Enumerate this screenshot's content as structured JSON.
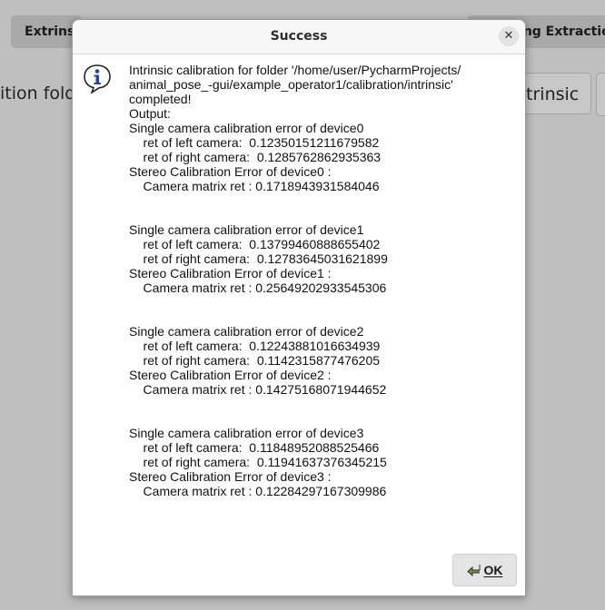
{
  "background": {
    "tab_extrinsic": "Extrinsi",
    "tab_extraction": "ding Extraction",
    "calibration_folder_label": "ition folde",
    "intrinsic_button": "ntrinsic"
  },
  "dialog": {
    "title": "Success",
    "close_icon": "close-icon",
    "icon": "info-icon",
    "message": "Intrinsic calibration for folder '/home/user/PycharmProjects/\nanimal_pose_-gui/example_operator1/calibration/intrinsic'\ncompleted!\nOutput:\nSingle camera calibration error of device0\n    ret of left camera:  0.12350151211679582\n    ret of right camera:  0.1285762862935363\nStereo Calibration Error of device0 :\n    Camera matrix ret : 0.1718943931584046\n\n\nSingle camera calibration error of device1\n    ret of left camera:  0.13799460888655402\n    ret of right camera:  0.12783645031621899\nStereo Calibration Error of device1 :\n    Camera matrix ret : 0.25649202933545306\n\n\nSingle camera calibration error of device2\n    ret of left camera:  0.12243881016634939\n    ret of right camera:  0.1142315877476205\nStereo Calibration Error of device2 :\n    Camera matrix ret : 0.14275168071944652\n\n\nSingle camera calibration error of device3\n    ret of left camera:  0.11848952088525466\n    ret of right camera:  0.11941637376345215\nStereo Calibration Error of device3 :\n    Camera matrix ret : 0.12284297167309986",
    "ok_label": "OK",
    "ok_icon": "ok-arrow-icon"
  }
}
